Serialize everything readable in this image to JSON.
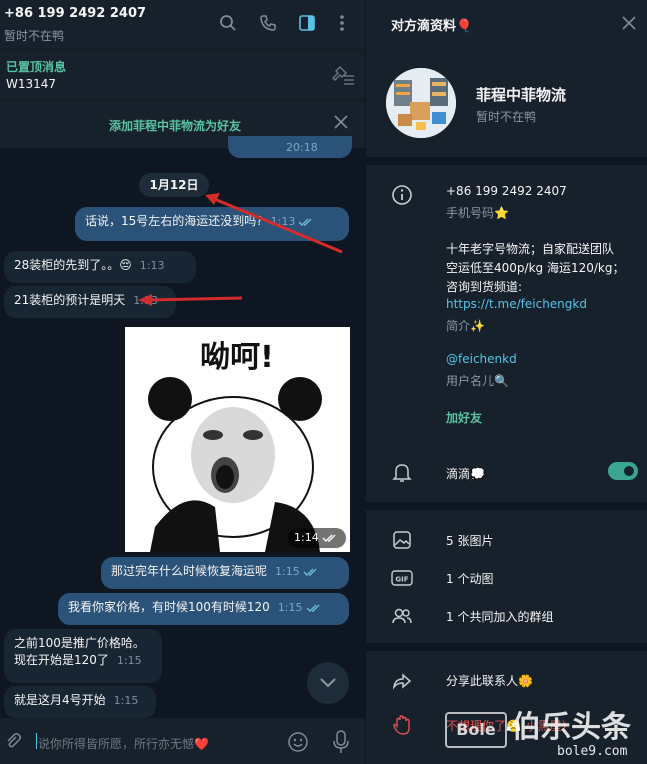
{
  "chat": {
    "header": {
      "title": "+86 199 2492 2407",
      "status": "暂时不在鸭"
    },
    "pinned": {
      "title": "已置顶消息",
      "text": "W13147"
    },
    "add_friend_bar": {
      "label": "添加菲程中菲物流为好友"
    },
    "partial_message": {
      "time": "20:18"
    },
    "date_badge": "1月12日",
    "messages": [
      {
        "text": "话说，15号左右的海运还没到吗?",
        "time": "1:13",
        "dir": "out"
      },
      {
        "text": "28装柜的先到了。。😔",
        "time": "1:13",
        "dir": "in"
      },
      {
        "text": "21装柜的预计是明天",
        "time": "1:13",
        "dir": "in"
      },
      {
        "text": "那过完年什么时候恢复海运呢",
        "time": "1:15",
        "dir": "out"
      },
      {
        "text": "我看你家价格，有时候100有时候120",
        "time": "1:15",
        "dir": "out"
      },
      {
        "text_line1": "之前100是推广价格哈。",
        "text_line2": "现在开始是120了",
        "time": "1:15",
        "dir": "in"
      },
      {
        "text": "就是这月4号开始",
        "time": "1:15",
        "dir": "in"
      }
    ],
    "sticker": {
      "caption": "呦呵!",
      "time": "1:14"
    },
    "input": {
      "placeholder": "说你所得皆所愿，所行亦无憾❤️"
    }
  },
  "profile": {
    "title": "对方滴资料🎈",
    "name": "菲程中菲物流",
    "status": "暂时不在鸭",
    "phone": "+86 199 2492 2407",
    "phone_label": "手机号码⭐",
    "bio_line1": "十年老字号物流；自家配送团队",
    "bio_line2": "空运低至400p/kg 海运120/kg；",
    "bio_line3": "咨询到货频道:",
    "bio_link": "https://t.me/feichengkd",
    "bio_label": "简介✨",
    "username": "@feichenkd",
    "username_label": "用户名儿🔍",
    "add_friend": "加好友",
    "notifications": "滴滴💭",
    "notifications_on": true,
    "media": [
      {
        "label": "5 张图片",
        "icon": "image-icon"
      },
      {
        "label": "1 个动图",
        "icon": "gif-icon"
      },
      {
        "label": "1 个共同加入的群组",
        "icon": "group-icon"
      }
    ],
    "share": "分享此联系人🌼",
    "block": "不想理你了😤(小黑屋)"
  },
  "watermark": {
    "brand": "伯乐头条",
    "logo": "Bole",
    "domain": "bole9.com"
  },
  "colors": {
    "accent": "#58c3a3",
    "link": "#58c3e8",
    "outgoing": "#2b5278",
    "incoming": "#182533",
    "background": "#0e1621",
    "panel": "#17212b",
    "block": "#e0524f",
    "arrow": "#d42b2b"
  }
}
